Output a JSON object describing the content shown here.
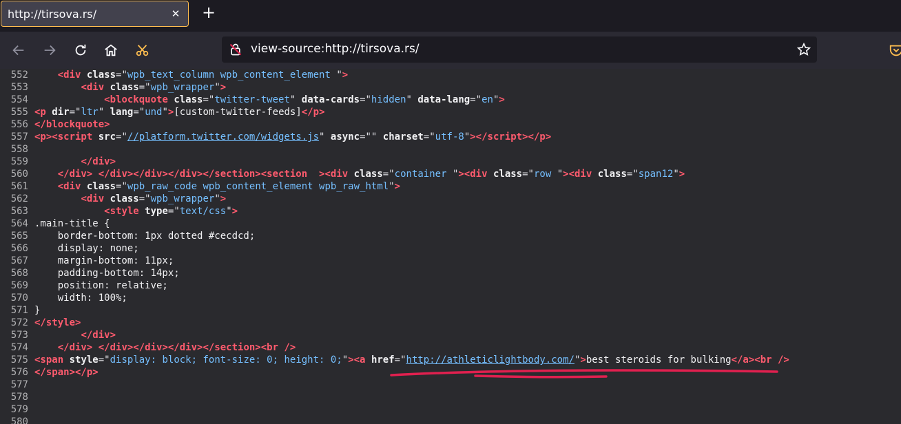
{
  "tab": {
    "title": "http://tirsova.rs/",
    "close_icon": "close-icon"
  },
  "toolbar": {
    "new_tab_label": "+",
    "url": "view-source:http://tirsova.rs/",
    "accent_color": "#ffbd4f"
  },
  "lines": [
    {
      "n": "552",
      "html": "    <span class=\"tag\">&lt;div</span> <span class=\"attr\">class</span>=\"<span class=\"val\">wpb_text_column wpb_content_element </span>\"<span class=\"tag\">&gt;</span>"
    },
    {
      "n": "553",
      "html": "        <span class=\"tag\">&lt;div</span> <span class=\"attr\">class</span>=\"<span class=\"val\">wpb_wrapper</span>\"<span class=\"tag\">&gt;</span>"
    },
    {
      "n": "554",
      "html": "            <span class=\"tag\">&lt;blockquote</span> <span class=\"attr\">class</span>=\"<span class=\"val\">twitter-tweet</span>\" <span class=\"attr\">data-cards</span>=\"<span class=\"val\">hidden</span>\" <span class=\"attr\">data-lang</span>=\"<span class=\"val\">en</span>\"<span class=\"tag\">&gt;</span>"
    },
    {
      "n": "555",
      "html": "<span class=\"tag\">&lt;p</span> <span class=\"attr\">dir</span>=\"<span class=\"val\">ltr</span>\" <span class=\"attr\">lang</span>=\"<span class=\"val\">und</span>\"<span class=\"tag\">&gt;</span><span class=\"txt\">[custom-twitter-feeds]</span><span class=\"tag\">&lt;/p&gt;</span>"
    },
    {
      "n": "556",
      "html": "<span class=\"tag\">&lt;/blockquote&gt;</span>"
    },
    {
      "n": "557",
      "html": "<span class=\"tag\">&lt;p&gt;&lt;script</span> <span class=\"attr\">src</span>=\"<span class=\"link\">//platform.twitter.com/widgets.js</span>\" <span class=\"attr\">async</span>=\"\" <span class=\"attr\">charset</span>=\"<span class=\"val\">utf-8</span>\"<span class=\"tag\">&gt;&lt;/script&gt;&lt;/p&gt;</span>"
    },
    {
      "n": "558",
      "html": ""
    },
    {
      "n": "559",
      "html": "        <span class=\"tag\">&lt;/div&gt;</span>"
    },
    {
      "n": "560",
      "html": "    <span class=\"tag\">&lt;/div&gt;</span> <span class=\"tag\">&lt;/div&gt;&lt;/div&gt;&lt;/div&gt;&lt;/section&gt;&lt;section</span>  <span class=\"tag\">&gt;&lt;div</span> <span class=\"attr\">class</span>=\"<span class=\"val\">container </span>\"<span class=\"tag\">&gt;&lt;div</span> <span class=\"attr\">class</span>=\"<span class=\"val\">row </span>\"<span class=\"tag\">&gt;&lt;div</span> <span class=\"attr\">class</span>=\"<span class=\"val\">span12</span>\"<span class=\"tag\">&gt;</span>"
    },
    {
      "n": "561",
      "html": "    <span class=\"tag\">&lt;div</span> <span class=\"attr\">class</span>=\"<span class=\"val\">wpb_raw_code wpb_content_element wpb_raw_html</span>\"<span class=\"tag\">&gt;</span>"
    },
    {
      "n": "562",
      "html": "        <span class=\"tag\">&lt;div</span> <span class=\"attr\">class</span>=\"<span class=\"val\">wpb_wrapper</span>\"<span class=\"tag\">&gt;</span>"
    },
    {
      "n": "563",
      "html": "            <span class=\"tag\">&lt;style</span> <span class=\"attr\">type</span>=\"<span class=\"val\">text/css</span>\"<span class=\"tag\">&gt;</span>"
    },
    {
      "n": "564",
      "html": "<span class=\"txt\">.main-title {</span>"
    },
    {
      "n": "565",
      "html": "<span class=\"txt\">    border-bottom: 1px dotted #cecdcd;</span>"
    },
    {
      "n": "566",
      "html": "<span class=\"txt\">    display: none;</span>"
    },
    {
      "n": "567",
      "html": "<span class=\"txt\">    margin-bottom: 11px;</span>"
    },
    {
      "n": "568",
      "html": "<span class=\"txt\">    padding-bottom: 14px;</span>"
    },
    {
      "n": "569",
      "html": "<span class=\"txt\">    position: relative;</span>"
    },
    {
      "n": "570",
      "html": "<span class=\"txt\">    width: 100%;</span>"
    },
    {
      "n": "571",
      "html": "<span class=\"txt\">}</span>"
    },
    {
      "n": "572",
      "html": "<span class=\"tag\">&lt;/style&gt;</span>"
    },
    {
      "n": "573",
      "html": "        <span class=\"tag\">&lt;/div&gt;</span>"
    },
    {
      "n": "574",
      "html": "    <span class=\"tag\">&lt;/div&gt;</span> <span class=\"tag\">&lt;/div&gt;&lt;/div&gt;&lt;/div&gt;&lt;/section&gt;&lt;br</span> <span class=\"tag\">/&gt;</span>"
    },
    {
      "n": "575",
      "html": "<span class=\"tag\">&lt;span</span> <span class=\"attr\">style</span>=\"<span class=\"val\">display: block; font-size: 0; height: 0;</span>\"<span class=\"tag\">&gt;&lt;a</span> <span class=\"attr\">href</span>=\"<span class=\"link\">http://athleticlightbody.com/</span>\"<span class=\"tag\">&gt;</span><span class=\"txt\">best steroids for bulking</span><span class=\"tag\">&lt;/a&gt;&lt;br</span> <span class=\"tag\">/&gt;</span>"
    },
    {
      "n": "576",
      "html": "<span class=\"tag\">&lt;/span&gt;&lt;/p&gt;</span>"
    },
    {
      "n": "577",
      "html": ""
    },
    {
      "n": "578",
      "html": ""
    },
    {
      "n": "579",
      "html": ""
    },
    {
      "n": "580",
      "html": ""
    }
  ]
}
